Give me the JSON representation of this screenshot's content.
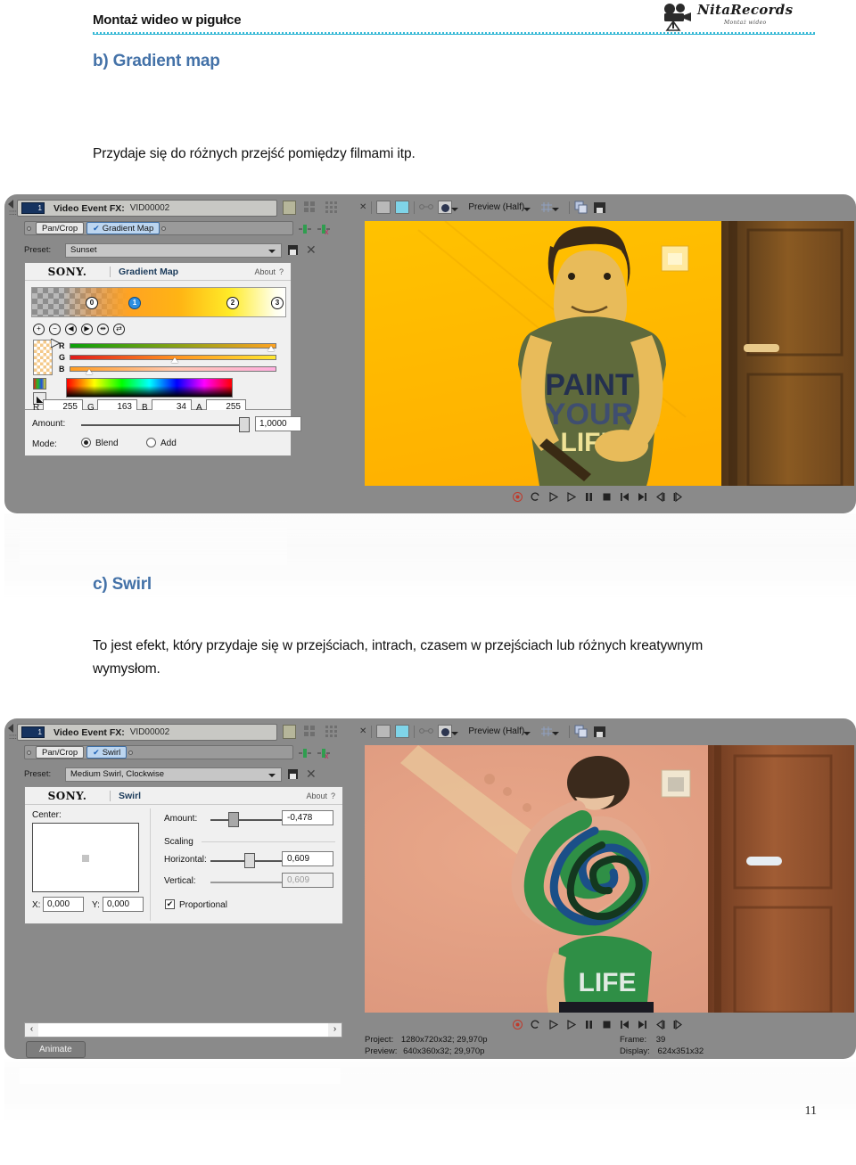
{
  "header": {
    "title": "Montaż wideo w pigułce",
    "logo_name": "NitaRecords",
    "logo_sub": "Montaż wideo",
    "accent_color": "#36b9d6"
  },
  "sections": [
    {
      "heading": "b) Gradient map",
      "paragraph": "Przydaje się do różnych przejść pomiędzy filmami itp."
    },
    {
      "heading": "c) Swirl",
      "paragraph": "To jest efekt, który przydaje się w przejściach, intrach, czasem w przejściach lub różnych kreatywnym wymysłom."
    }
  ],
  "shot_gradient": {
    "window_title": "Video Event FX:",
    "window_value": "VID00002",
    "track_number": "1",
    "chain": [
      {
        "label": "Pan/Crop",
        "selected": false,
        "checked": false
      },
      {
        "label": "Gradient Map",
        "selected": true,
        "checked": true
      }
    ],
    "preset_label": "Preset:",
    "preset_value": "Sunset",
    "plugin_vendor": "SONY.",
    "plugin_name": "Gradient Map",
    "about_label": "About",
    "help_glyph": "?",
    "gradient_stops": [
      "0",
      "1",
      "2",
      "3"
    ],
    "active_stop_index": 1,
    "stop_buttons": [
      "add-stop",
      "remove-stop",
      "move-left",
      "move-right",
      "distribute",
      "flip"
    ],
    "channels": [
      "R",
      "G",
      "B"
    ],
    "color_fields": [
      {
        "label": "R",
        "value": "255"
      },
      {
        "label": "G",
        "value": "163"
      },
      {
        "label": "B",
        "value": "34"
      },
      {
        "label": "A",
        "value": "255"
      }
    ],
    "amount_label": "Amount:",
    "amount_value": "1,0000",
    "mode_label": "Mode:",
    "mode_options": [
      "Blend",
      "Add"
    ],
    "mode_selected": "Blend",
    "preview": {
      "toolbar_label": "Preview (Half)",
      "transport": [
        "record",
        "loop",
        "play-half",
        "play",
        "pause",
        "stop",
        "prev-frame-jump",
        "next-frame-jump",
        "step-back",
        "step-forward"
      ]
    }
  },
  "shot_swirl": {
    "window_title": "Video Event FX:",
    "window_value": "VID00002",
    "track_number": "1",
    "chain": [
      {
        "label": "Pan/Crop",
        "selected": false,
        "checked": false
      },
      {
        "label": "Swirl",
        "selected": true,
        "checked": true
      }
    ],
    "preset_label": "Preset:",
    "preset_value": "Medium Swirl, Clockwise",
    "plugin_vendor": "SONY.",
    "plugin_name": "Swirl",
    "about_label": "About",
    "help_glyph": "?",
    "center_label": "Center:",
    "center_x_label": "X:",
    "center_x_value": "0,000",
    "center_y_label": "Y:",
    "center_y_value": "0,000",
    "amount_label": "Amount:",
    "amount_value": "-0,478",
    "scaling_label": "Scaling",
    "horizontal_label": "Horizontal:",
    "horizontal_value": "0,609",
    "vertical_label": "Vertical:",
    "vertical_value": "0,609",
    "proportional_label": "Proportional",
    "proportional_checked": true,
    "animate_label": "Animate",
    "scroll_left_glyph": "‹",
    "scroll_right_glyph": "›",
    "preview": {
      "toolbar_label": "Preview (Half)",
      "status": {
        "project_label": "Project:",
        "project_value": "1280x720x32; 29,970p",
        "preview_label": "Preview:",
        "preview_value": "640x360x32; 29,970p",
        "frame_label": "Frame:",
        "frame_value": "39",
        "display_label": "Display:",
        "display_value": "624x351x32"
      }
    }
  },
  "footer": {
    "page_number": "11"
  }
}
